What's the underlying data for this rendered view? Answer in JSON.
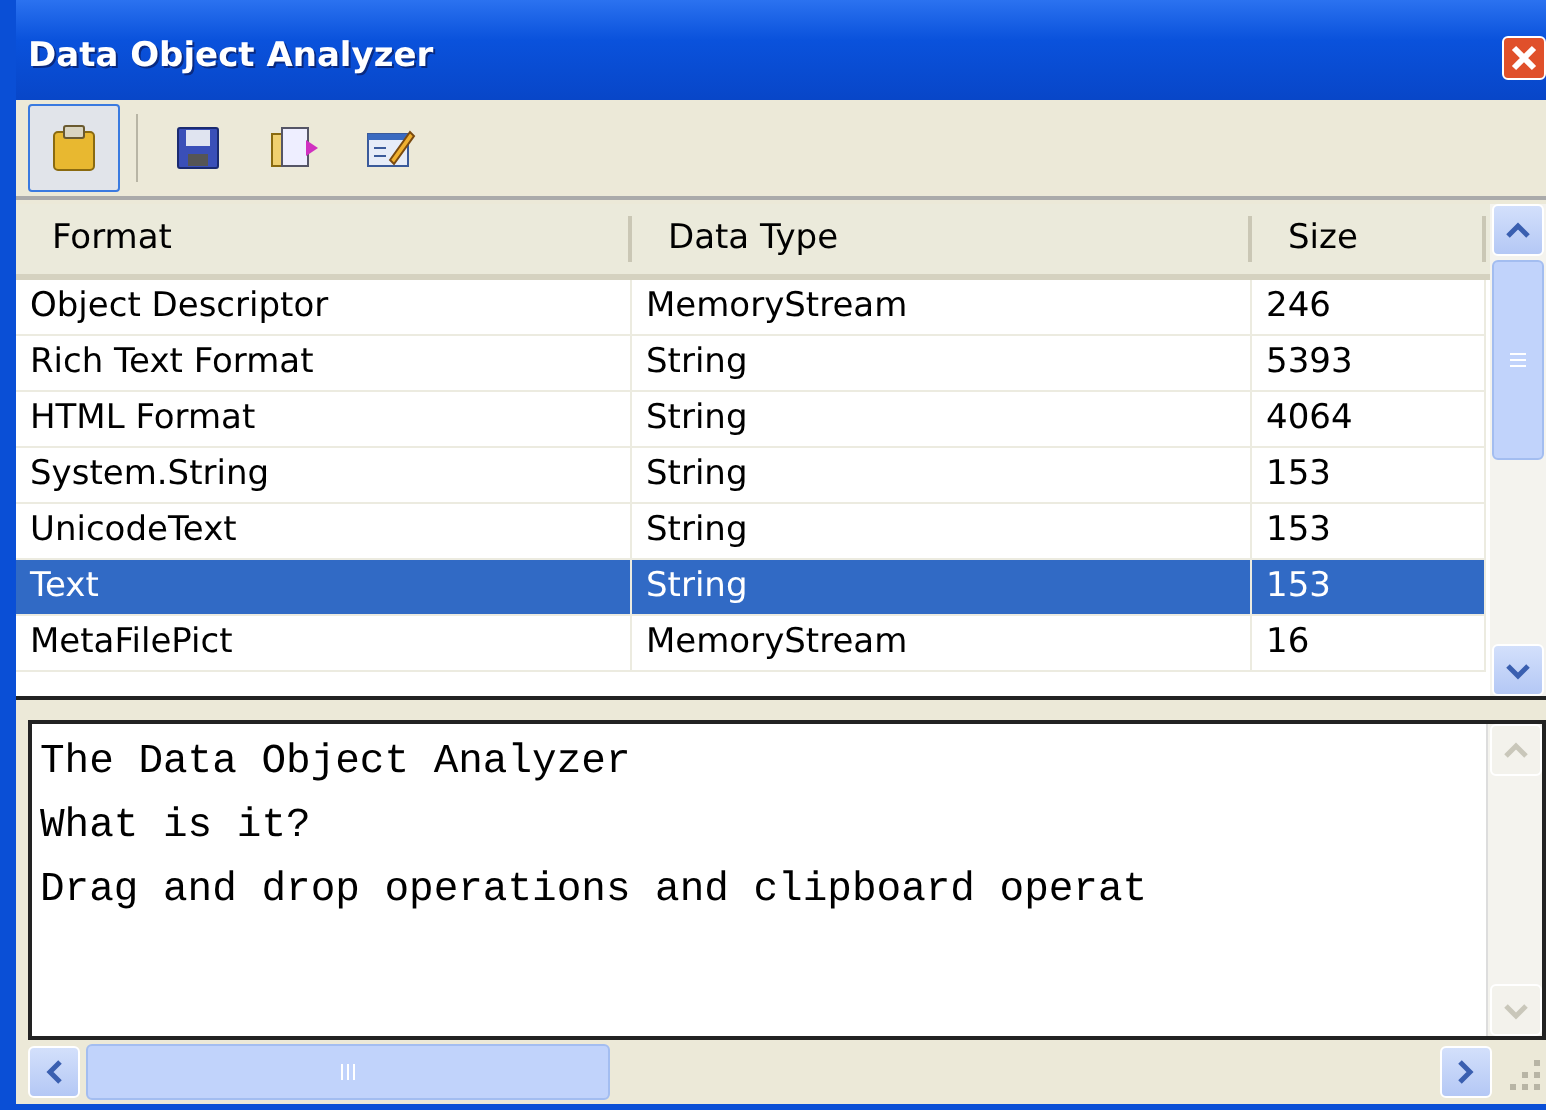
{
  "window": {
    "title": "Data Object Analyzer"
  },
  "toolbar": [
    {
      "kind": "clipboard",
      "selected": true
    },
    {
      "kind": "save",
      "selected": false
    },
    {
      "kind": "export",
      "selected": false
    },
    {
      "kind": "edit",
      "selected": false
    }
  ],
  "table": {
    "columns": [
      "Format",
      "Data Type",
      "Size"
    ],
    "rows": [
      {
        "cells": [
          "Object Descriptor",
          "MemoryStream",
          "246"
        ],
        "selected": false
      },
      {
        "cells": [
          "Rich Text Format",
          "String",
          "5393"
        ],
        "selected": false
      },
      {
        "cells": [
          "HTML Format",
          "String",
          "4064"
        ],
        "selected": false
      },
      {
        "cells": [
          "System.String",
          "String",
          "153"
        ],
        "selected": false
      },
      {
        "cells": [
          "UnicodeText",
          "String",
          "153"
        ],
        "selected": false
      },
      {
        "cells": [
          "Text",
          "String",
          "153"
        ],
        "selected": true
      },
      {
        "cells": [
          "MetaFilePict",
          "MemoryStream",
          "16"
        ],
        "selected": false
      }
    ]
  },
  "text_view": {
    "lines": [
      "The Data Object Analyzer",
      "What is it?",
      "Drag and drop operations and clipboard operat"
    ]
  }
}
